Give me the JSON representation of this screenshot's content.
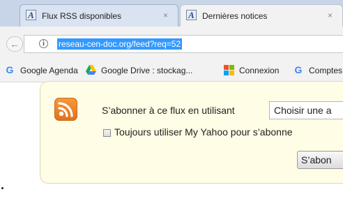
{
  "tabs": [
    {
      "title": "Flux RSS disponibles",
      "favicon": "A",
      "close": "×"
    },
    {
      "title": "Dernières notices",
      "favicon": "A",
      "close": "×"
    }
  ],
  "address_bar": {
    "url": "reseau-cen-doc.org/feed?req=52",
    "info_icon": "i",
    "back_icon": "←"
  },
  "bookmarks": [
    {
      "label": "Google Agenda",
      "icon": "google-icon"
    },
    {
      "label": "Google Drive : stockag...",
      "icon": "google-drive-icon"
    },
    {
      "label": "Connexion",
      "icon": "microsoft-icon"
    },
    {
      "label": "Comptes",
      "icon": "google-icon"
    }
  ],
  "feed_panel": {
    "subscribe_label": "S’abonner à ce flux en utilisant",
    "reader_selected": "Choisir une a",
    "always_use_label": "Toujours utiliser My Yahoo pour s’abonne",
    "always_use_checked": false,
    "subscribe_button": "S’abon"
  },
  "colors": {
    "url_highlight": "#3399ff",
    "panel_background": "#fffde6",
    "rss_orange": "#f08a2c"
  }
}
